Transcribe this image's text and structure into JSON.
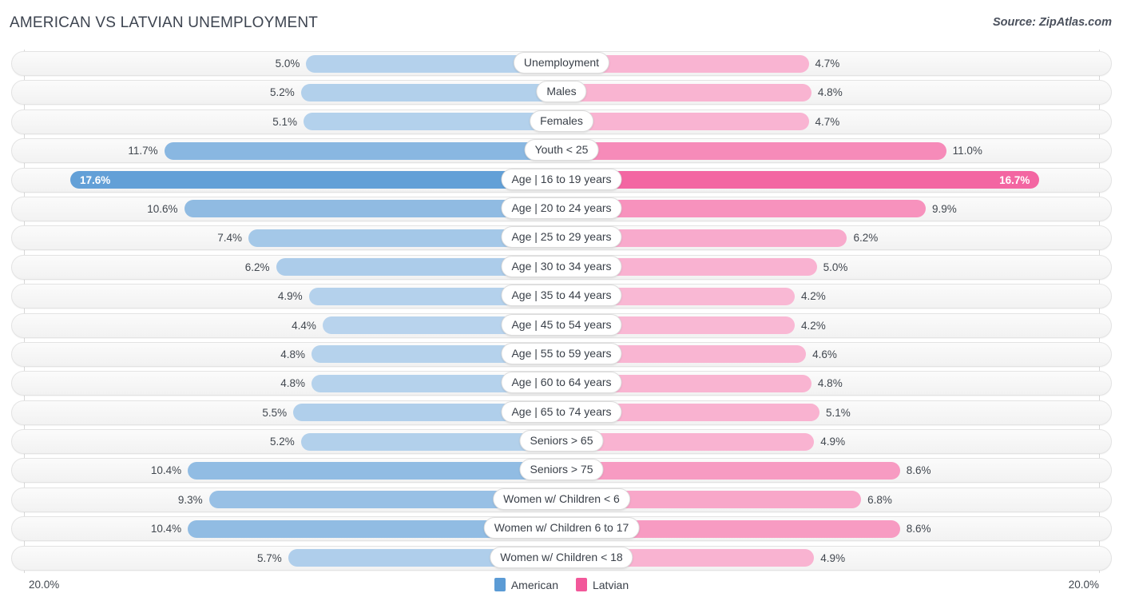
{
  "header": {
    "title": "AMERICAN VS LATVIAN UNEMPLOYMENT",
    "source": "Source: ZipAtlas.com"
  },
  "footer": {
    "axis_left": "20.0%",
    "axis_right": "20.0%",
    "legend": [
      {
        "label": "American",
        "color": "#5b9bd5"
      },
      {
        "label": "Latvian",
        "color": "#f2589a"
      }
    ]
  },
  "chart_data": {
    "type": "bar",
    "subtype": "diverging-bidirectional",
    "title": "AMERICAN VS LATVIAN UNEMPLOYMENT",
    "xlabel": "",
    "ylabel": "",
    "xlim": [
      0,
      20.0
    ],
    "axis_max_label": "20.0%",
    "grid": true,
    "legend_position": "bottom-center",
    "series": [
      {
        "name": "American",
        "color": "#5b9bd5",
        "side": "left",
        "values": [
          5.0,
          5.2,
          5.1,
          11.7,
          17.6,
          10.6,
          7.4,
          6.2,
          4.9,
          4.4,
          4.8,
          4.8,
          5.5,
          5.2,
          10.4,
          9.3,
          10.4,
          5.7
        ]
      },
      {
        "name": "Latvian",
        "color": "#f2589a",
        "side": "right",
        "values": [
          4.7,
          4.8,
          4.7,
          11.0,
          16.7,
          9.9,
          6.2,
          5.0,
          4.2,
          4.2,
          4.6,
          4.8,
          5.1,
          4.9,
          8.6,
          6.8,
          8.6,
          4.9
        ]
      }
    ],
    "categories": [
      "Unemployment",
      "Males",
      "Females",
      "Youth < 25",
      "Age | 16 to 19 years",
      "Age | 20 to 24 years",
      "Age | 25 to 29 years",
      "Age | 30 to 34 years",
      "Age | 35 to 44 years",
      "Age | 45 to 54 years",
      "Age | 55 to 59 years",
      "Age | 60 to 64 years",
      "Age | 65 to 74 years",
      "Seniors > 65",
      "Seniors > 75",
      "Women w/ Children < 6",
      "Women w/ Children 6 to 17",
      "Women w/ Children < 18"
    ],
    "rows": [
      {
        "label": "Unemployment",
        "left_value": 5.0,
        "left_text": "5.0%",
        "right_value": 4.7,
        "right_text": "4.7%"
      },
      {
        "label": "Males",
        "left_value": 5.2,
        "left_text": "5.2%",
        "right_value": 4.8,
        "right_text": "4.8%"
      },
      {
        "label": "Females",
        "left_value": 5.1,
        "left_text": "5.1%",
        "right_value": 4.7,
        "right_text": "4.7%"
      },
      {
        "label": "Youth < 25",
        "left_value": 11.7,
        "left_text": "11.7%",
        "right_value": 11.0,
        "right_text": "11.0%"
      },
      {
        "label": "Age | 16 to 19 years",
        "left_value": 17.6,
        "left_text": "17.6%",
        "right_value": 16.7,
        "right_text": "16.7%"
      },
      {
        "label": "Age | 20 to 24 years",
        "left_value": 10.6,
        "left_text": "10.6%",
        "right_value": 9.9,
        "right_text": "9.9%"
      },
      {
        "label": "Age | 25 to 29 years",
        "left_value": 7.4,
        "left_text": "7.4%",
        "right_value": 6.2,
        "right_text": "6.2%"
      },
      {
        "label": "Age | 30 to 34 years",
        "left_value": 6.2,
        "left_text": "6.2%",
        "right_value": 5.0,
        "right_text": "5.0%"
      },
      {
        "label": "Age | 35 to 44 years",
        "left_value": 4.9,
        "left_text": "4.9%",
        "right_value": 4.2,
        "right_text": "4.2%"
      },
      {
        "label": "Age | 45 to 54 years",
        "left_value": 4.4,
        "left_text": "4.4%",
        "right_value": 4.2,
        "right_text": "4.2%"
      },
      {
        "label": "Age | 55 to 59 years",
        "left_value": 4.8,
        "left_text": "4.8%",
        "right_value": 4.6,
        "right_text": "4.6%"
      },
      {
        "label": "Age | 60 to 64 years",
        "left_value": 4.8,
        "left_text": "4.8%",
        "right_value": 4.8,
        "right_text": "4.8%"
      },
      {
        "label": "Age | 65 to 74 years",
        "left_value": 5.5,
        "left_text": "5.5%",
        "right_value": 5.1,
        "right_text": "5.1%"
      },
      {
        "label": "Seniors > 65",
        "left_value": 5.2,
        "left_text": "5.2%",
        "right_value": 4.9,
        "right_text": "4.9%"
      },
      {
        "label": "Seniors > 75",
        "left_value": 10.4,
        "left_text": "10.4%",
        "right_value": 8.6,
        "right_text": "8.6%"
      },
      {
        "label": "Women w/ Children < 6",
        "left_value": 9.3,
        "left_text": "9.3%",
        "right_value": 6.8,
        "right_text": "6.8%"
      },
      {
        "label": "Women w/ Children 6 to 17",
        "left_value": 10.4,
        "left_text": "10.4%",
        "right_value": 8.6,
        "right_text": "8.6%"
      },
      {
        "label": "Women w/ Children < 18",
        "left_value": 5.7,
        "left_text": "5.7%",
        "right_value": 4.9,
        "right_text": "4.9%"
      }
    ]
  }
}
